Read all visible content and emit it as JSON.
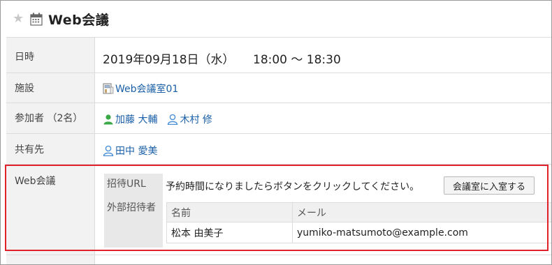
{
  "header": {
    "title": "Web会議",
    "star_icon": "star-icon",
    "calendar_icon": "calendar-icon"
  },
  "rows": {
    "datetime": {
      "label": "日時",
      "date": "2019年09月18日（水）",
      "time_range": "18:00 ～ 18:30"
    },
    "facility": {
      "label": "施設",
      "value": "Web会議室01",
      "icon": "facility-icon"
    },
    "participants": {
      "label": "参加者 （2名）",
      "users": [
        "加藤 大輔",
        "木村 修"
      ],
      "icon": "user-icon"
    },
    "shared": {
      "label": "共有先",
      "users": [
        "田中 愛美"
      ]
    },
    "web_meeting": {
      "label": "Web会議",
      "invite_url_label": "招待URL",
      "invite_text": "予約時間になりましたらボタンをクリックしてください。",
      "enter_button": "会議室に入室する",
      "external_label": "外部招待者",
      "table": {
        "headers": [
          "名前",
          "メール"
        ],
        "rows": [
          [
            "松本 由美子",
            "yumiko-matsumoto@example.com"
          ]
        ]
      }
    }
  },
  "colors": {
    "link": "#1a5fa8",
    "highlight_border": "#e0202a",
    "user_icon_green": "#3aa845",
    "user_icon_blue": "#4a8fd6"
  }
}
